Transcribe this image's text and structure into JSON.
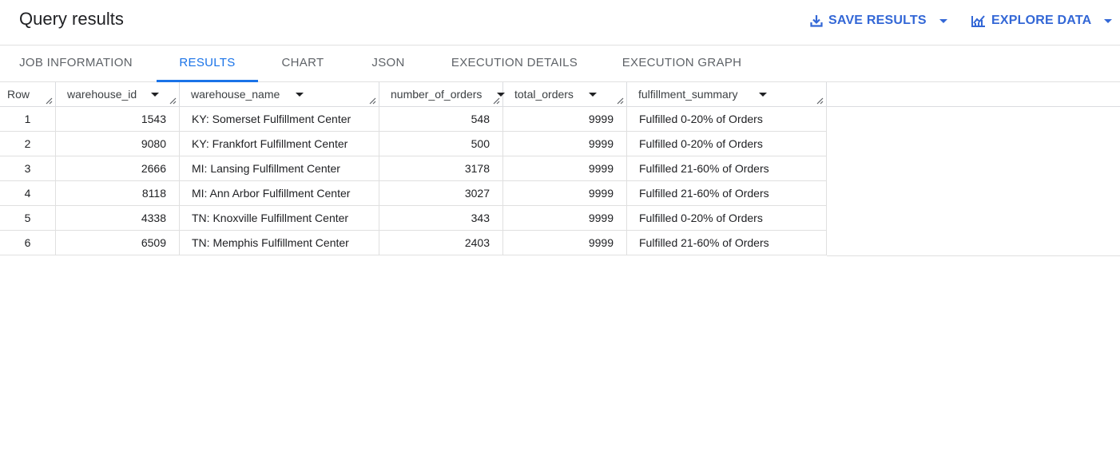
{
  "header": {
    "title": "Query results",
    "save_results_label": "SAVE RESULTS",
    "explore_data_label": "EXPLORE DATA",
    "save_icon": "download-icon",
    "explore_icon": "chart-icon"
  },
  "tabs": [
    {
      "label": "JOB INFORMATION",
      "active": false
    },
    {
      "label": "RESULTS",
      "active": true
    },
    {
      "label": "CHART",
      "active": false
    },
    {
      "label": "JSON",
      "active": false
    },
    {
      "label": "EXECUTION DETAILS",
      "active": false
    },
    {
      "label": "EXECUTION GRAPH",
      "active": false
    }
  ],
  "table": {
    "columns": [
      "Row",
      "warehouse_id",
      "warehouse_name",
      "number_of_orders",
      "total_orders",
      "fulfillment_summary"
    ],
    "rows": [
      [
        "1",
        "1543",
        "KY: Somerset Fulfillment Center",
        "548",
        "9999",
        "Fulfilled 0-20% of Orders"
      ],
      [
        "2",
        "9080",
        "KY: Frankfort Fulfillment Center",
        "500",
        "9999",
        "Fulfilled 0-20% of Orders"
      ],
      [
        "3",
        "2666",
        "MI: Lansing Fulfillment Center",
        "3178",
        "9999",
        "Fulfilled 21-60% of Orders"
      ],
      [
        "4",
        "8118",
        "MI: Ann Arbor Fulfillment Center",
        "3027",
        "9999",
        "Fulfilled 21-60% of Orders"
      ],
      [
        "5",
        "4338",
        "TN: Knoxville Fulfillment Center",
        "343",
        "9999",
        "Fulfilled 0-20% of Orders"
      ],
      [
        "6",
        "6509",
        "TN: Memphis Fulfillment Center",
        "2403",
        "9999",
        "Fulfilled 21-60% of Orders"
      ]
    ]
  },
  "colors": {
    "accent": "#1a73e8",
    "text": "#202124",
    "border": "#e0e0e0"
  }
}
